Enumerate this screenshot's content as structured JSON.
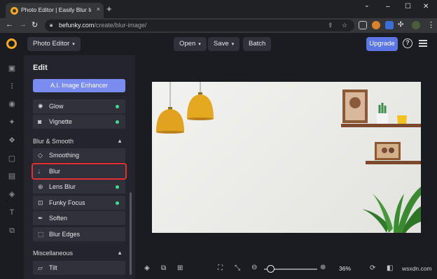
{
  "browser": {
    "tab_title": "Photo Editor | Easily Blur Images",
    "tab_close": "×",
    "new_tab": "+",
    "window_controls": [
      "–",
      "☐",
      "✕"
    ],
    "url_host": "befunky.com",
    "url_path": "/create/blur-image/"
  },
  "header": {
    "app_menu": "Photo Editor",
    "open": "Open",
    "save": "Save",
    "batch": "Batch",
    "upgrade": "Upgrade",
    "help": "?"
  },
  "panel": {
    "title": "Edit",
    "ai_button": "A.I. Image Enhancer",
    "effects": [
      {
        "label": "Glow",
        "icon": "glow-icon",
        "premium": true
      },
      {
        "label": "Vignette",
        "icon": "vignette-icon",
        "premium": true
      }
    ],
    "blur_section": "Blur & Smooth",
    "blur_items": [
      {
        "label": "Smoothing",
        "icon": "diamond-icon",
        "premium": false
      },
      {
        "label": "Blur",
        "icon": "droplet-icon",
        "premium": false,
        "selected": true
      },
      {
        "label": "Lens Blur",
        "icon": "aperture-icon",
        "premium": true
      },
      {
        "label": "Funky Focus",
        "icon": "focus-icon",
        "premium": true
      },
      {
        "label": "Soften",
        "icon": "feather-icon",
        "premium": false
      },
      {
        "label": "Blur Edges",
        "icon": "blur-edges-icon",
        "premium": false
      }
    ],
    "misc_section": "Miscellaneous",
    "misc_items": [
      {
        "label": "Tilt",
        "icon": "tilt-icon",
        "premium": false
      }
    ]
  },
  "bottom": {
    "zoom": "36%",
    "zoom_fraction": 0.12,
    "watermark": "wsxdn.com"
  },
  "colors": {
    "accent": "#5c76e6",
    "ai_button": "#7a8cf0",
    "premium_dot": "#3ddc97",
    "highlight": "#e03131"
  }
}
